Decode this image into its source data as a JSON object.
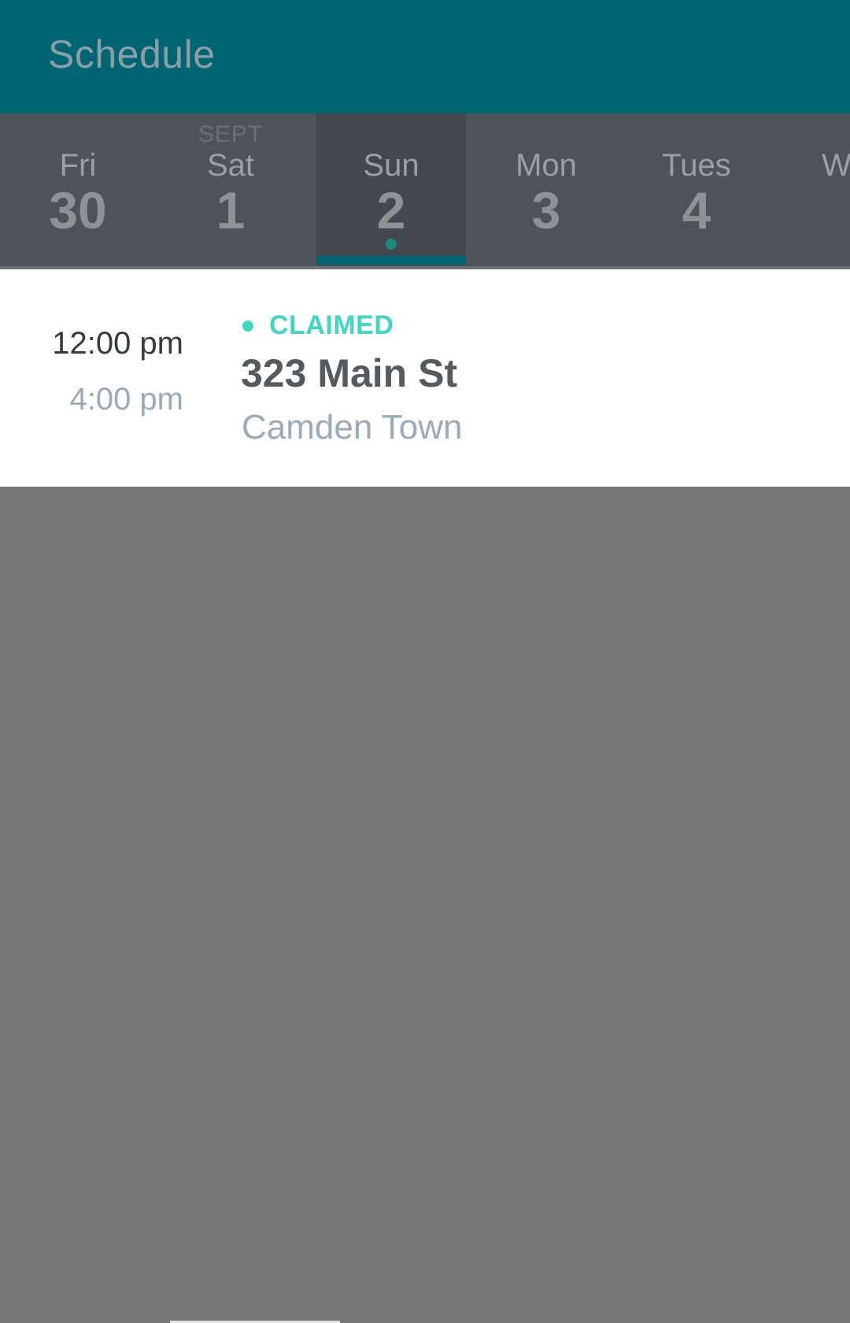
{
  "app_bar": {
    "title": "Schedule",
    "color": "#006572"
  },
  "date_strip": {
    "month_label": "SEPT",
    "days": [
      {
        "name": "Fri",
        "number": "30",
        "selected": false,
        "has_event": false
      },
      {
        "name": "Sat",
        "number": "1",
        "selected": false,
        "has_event": false
      },
      {
        "name": "Sun",
        "number": "2",
        "selected": true,
        "has_event": true
      },
      {
        "name": "Mon",
        "number": "3",
        "selected": false,
        "has_event": false
      },
      {
        "name": "Tues",
        "number": "4",
        "selected": false,
        "has_event": false
      },
      {
        "name": "W",
        "number": "",
        "selected": false,
        "has_event": false
      }
    ]
  },
  "shift": {
    "start_time": "12:00 pm",
    "end_time": "4:00 pm",
    "status": "CLAIMED",
    "status_color": "#3fd7c4",
    "address": "323 Main St",
    "neighborhood": "Camden Town"
  }
}
